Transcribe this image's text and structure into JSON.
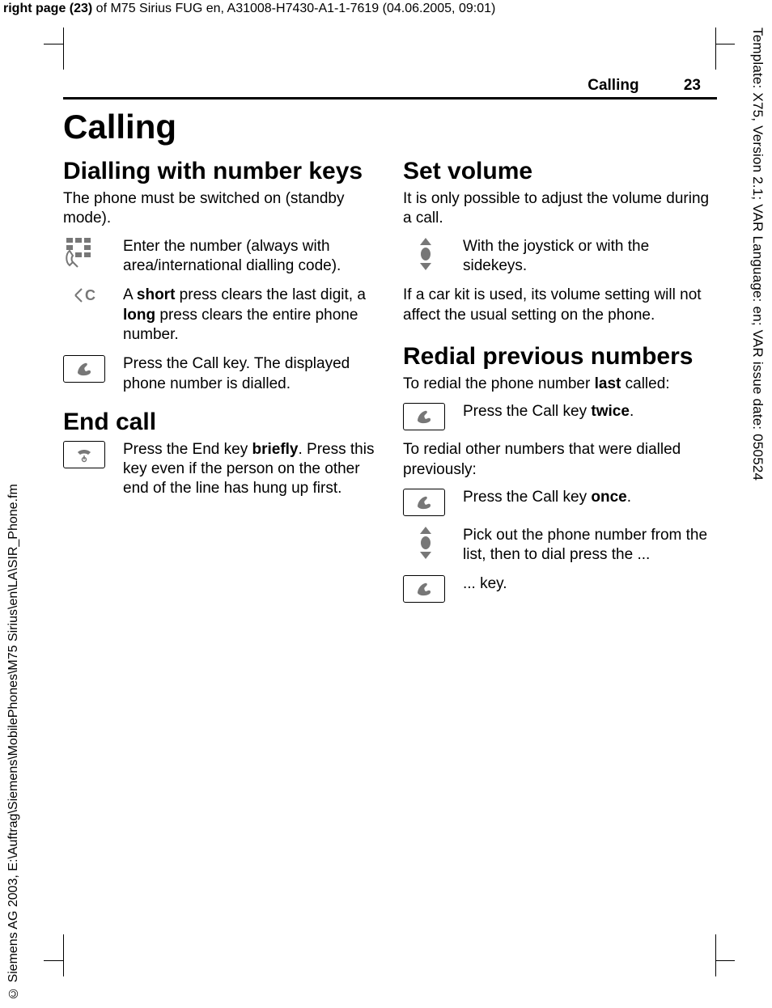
{
  "meta": {
    "top_bold": "right page (23)",
    "top_rest": " of M75 Sirius FUG en, A31008-H7430-A1-1-7619 (04.06.2005, 09:01)",
    "vert_right": "Template: X75, Version 2.1; VAR Language: en; VAR issue date: 050524",
    "vert_left": "© Siemens AG 2003,  E:\\Auftrag\\Siemens\\MobilePhones\\M75 Sirius\\en\\LA\\SIR_Phone.fm"
  },
  "header": {
    "section": "Calling",
    "page_num": "23"
  },
  "h1": "Calling",
  "left": {
    "sec1_title": "Dialling with number keys",
    "sec1_intro": "The phone must be switched on (standby mode).",
    "item1": "Enter the number (always with area/international dialling code).",
    "item2_pre": "A ",
    "item2_b1": "short",
    "item2_mid": " press clears the last digit, a ",
    "item2_b2": "long",
    "item2_post": " press clears the entire phone number.",
    "item3": "Press the Call key. The displayed phone number is dialled.",
    "sec2_title": "End call",
    "item4_pre": "Press the End key ",
    "item4_b": "briefly",
    "item4_post": ". Press this key even if the person on the other end of the line has hung up first."
  },
  "right": {
    "sec1_title": "Set volume",
    "sec1_intro": "It is only possible to adjust the volume during a call.",
    "item1": "With the joystick or with the sidekeys.",
    "sec1_after": "If a car kit is used, its volume setting will not affect the usual setting on the phone.",
    "sec2_title": "Redial previous numbers",
    "sec2_intro_pre": "To redial the phone number ",
    "sec2_intro_b": "last",
    "sec2_intro_post": " called:",
    "item2_pre": "Press the Call key ",
    "item2_b": "twice",
    "item2_post": ".",
    "sec2_mid": "To redial other numbers that were dialled previously:",
    "item3_pre": "Press the Call key ",
    "item3_b": "once",
    "item3_post": ".",
    "item4": "Pick out the phone number from the list, then to dial press the ...",
    "item5": "... key."
  }
}
